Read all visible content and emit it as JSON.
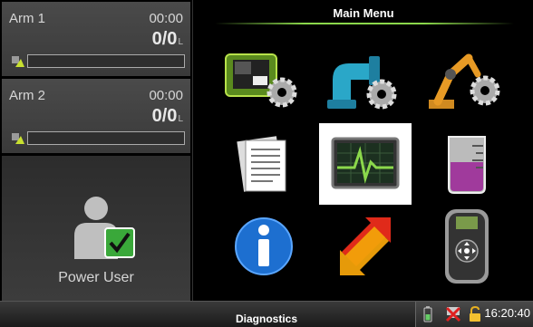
{
  "arms": [
    {
      "name": "Arm 1",
      "time": "00:00",
      "volume": "0/0",
      "unit": "L",
      "progress": 0
    },
    {
      "name": "Arm 2",
      "time": "00:00",
      "volume": "0/0",
      "unit": "L",
      "progress": 0
    }
  ],
  "user": {
    "label": "Power User"
  },
  "main": {
    "title": "Main Menu"
  },
  "menu_items": [
    {
      "icon": "device-settings-icon"
    },
    {
      "icon": "piping-settings-icon"
    },
    {
      "icon": "robot-arm-settings-icon"
    },
    {
      "icon": "documents-icon"
    },
    {
      "icon": "diagnostics-monitor-icon",
      "selected": true
    },
    {
      "icon": "beaker-icon"
    },
    {
      "icon": "info-icon"
    },
    {
      "icon": "transfer-arrows-icon"
    },
    {
      "icon": "handheld-controller-icon"
    }
  ],
  "status": {
    "title": "Diagnostics",
    "clock": "16:20:40",
    "icons": [
      "battery-icon",
      "network-icon",
      "unlocked-lock-icon"
    ]
  },
  "colors": {
    "accent": "#8bd84b",
    "check": "#3aa83a"
  }
}
